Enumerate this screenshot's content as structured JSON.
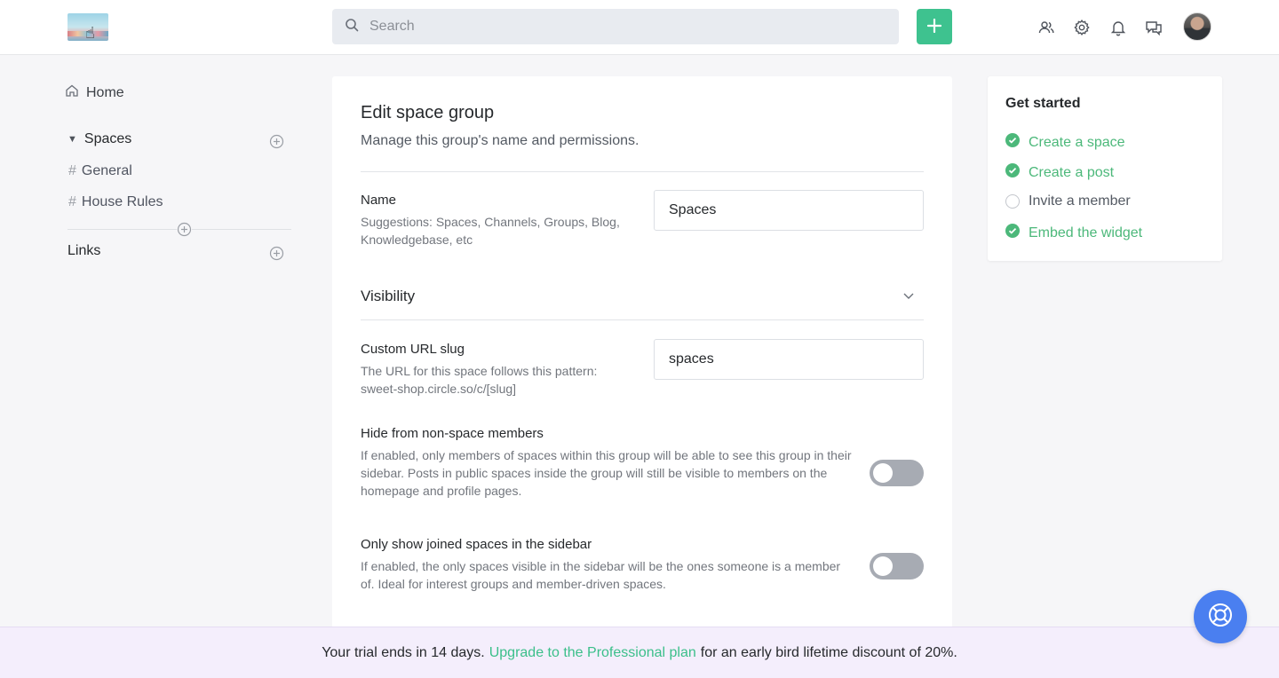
{
  "header": {
    "search_placeholder": "Search",
    "icons": [
      "members-icon",
      "gear-icon",
      "bell-icon",
      "chat-icon"
    ],
    "accent": "#3ec28f"
  },
  "sidebar": {
    "home_label": "Home",
    "spaces_label": "Spaces",
    "items": [
      {
        "label": "General"
      },
      {
        "label": "House Rules"
      }
    ],
    "links_label": "Links"
  },
  "form": {
    "title": "Edit space group",
    "subtitle": "Manage this group's name and permissions.",
    "name_label": "Name",
    "name_help": "Suggestions: Spaces, Channels, Groups, Blog, Knowledgebase, etc",
    "name_value": "Spaces",
    "visibility_label": "Visibility",
    "slug_label": "Custom URL slug",
    "slug_help": "The URL for this space follows this pattern: sweet-shop.circle.so/c/[slug]",
    "slug_value": "spaces",
    "hide_label": "Hide from non-space members",
    "hide_help": "If enabled, only members of spaces within this group will be able to see this group in their sidebar. Posts in public spaces inside the group will still be visible to members on the homepage and profile pages.",
    "hide_enabled": false,
    "joined_label": "Only show joined spaces in the sidebar",
    "joined_help": "If enabled, the only spaces visible in the sidebar will be the ones someone is a member of. Ideal for interest groups and member-driven spaces.",
    "joined_enabled": false
  },
  "get_started": {
    "title": "Get started",
    "items": [
      {
        "label": "Create a space",
        "done": true
      },
      {
        "label": "Create a post",
        "done": true
      },
      {
        "label": "Invite a member",
        "done": false
      },
      {
        "label": "Embed the widget",
        "done": true
      }
    ],
    "done_color": "#4cb87a"
  },
  "banner": {
    "text_before": "Your trial ends in 14 days.",
    "link": "Upgrade to the Professional plan",
    "text_after": "for an early bird lifetime discount of 20%."
  },
  "help_button_color": "#4a7ff0"
}
